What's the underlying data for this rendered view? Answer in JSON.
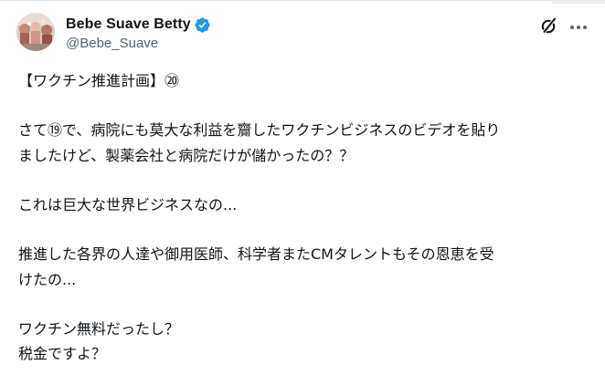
{
  "author": {
    "display_name": "Bebe Suave Betty",
    "handle": "@Bebe_Suave",
    "avatar_icon": "avatar-photo",
    "verified_icon": "verified-badge-icon"
  },
  "actions": {
    "grok_icon": "grok-icon",
    "more_icon": "more-options-icon"
  },
  "tweet": {
    "paragraphs": [
      [
        "【ワクチン推進計画】⑳"
      ],
      [
        "さて⑲で、病院にも莫大な利益を齎したワクチンビジネスのビデオを貼り",
        "ましたけど、製薬会社と病院だけが儲かったの？？"
      ],
      [
        "これは巨大な世界ビジネスなの..."
      ],
      [
        "推進した各界の人達や御用医師、科学者またCMタレントもその恩恵を受",
        "けたの..."
      ],
      [
        "ワクチン無料だったし？",
        "税金ですよ？"
      ]
    ]
  },
  "colors": {
    "text": "#0f1419",
    "secondary_text": "#536471",
    "verified_blue": "#1d9bf0",
    "background": "#ffffff"
  }
}
